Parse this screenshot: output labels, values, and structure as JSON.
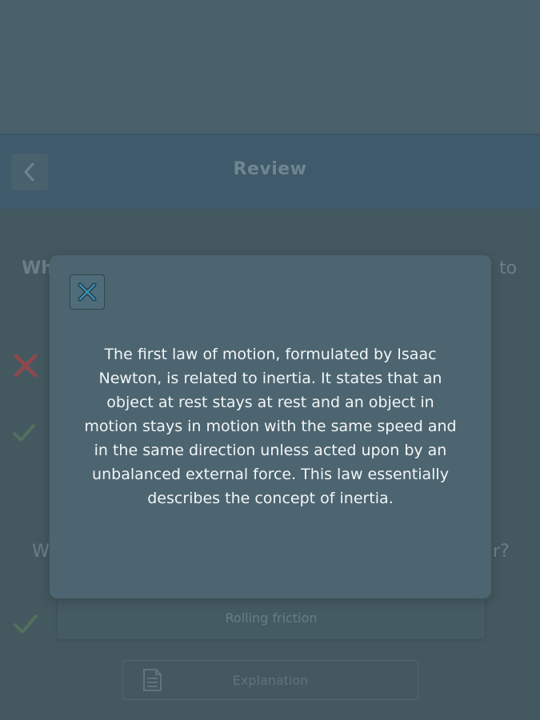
{
  "header": {
    "title": "Review",
    "back_icon": "chevron-left-icon"
  },
  "background": {
    "question1_start": "Wh",
    "question1_end": "to",
    "question2_start": "W",
    "question2_end": "r?",
    "answer_text": "Rolling friction",
    "explanation_label": "Explanation",
    "wrong_icon": "x-mark-icon",
    "correct_icon": "check-icon",
    "explanation_icon": "document-icon"
  },
  "modal": {
    "close_icon": "close-icon",
    "text": "The first law of motion, formulated by Isaac Newton, is related to inertia. It states that an object at rest stays at rest and an object in motion stays in motion with the same speed and in the same direction unless acted upon by an unbalanced external force. This law essentially describes the concept of inertia."
  },
  "colors": {
    "overlay_bg": "#4a606a",
    "header_bg": "#3f5a6b",
    "modal_bg": "#4c6570",
    "modal_text": "#f2f5f6",
    "wrong_mark": "#8a4a4d",
    "correct_mark": "#51705e"
  }
}
